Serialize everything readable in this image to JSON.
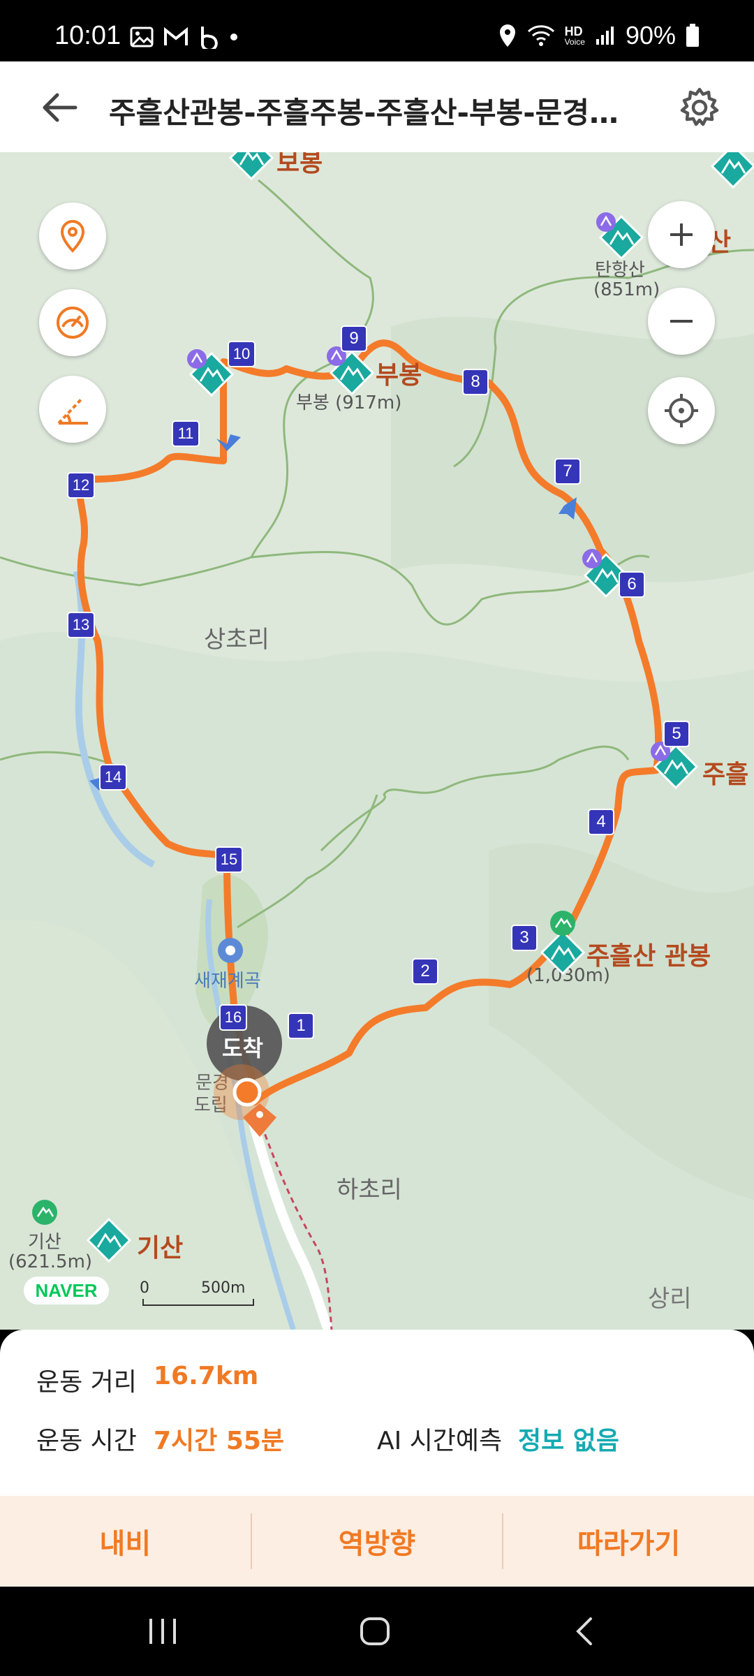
{
  "status_bar": {
    "time": "10:01",
    "battery": "90%",
    "hd_label": "HD",
    "voice_label": "Voice"
  },
  "header": {
    "title": "주흘산관봉-주흘주봉-주흘산-부봉-문경새...",
    "back_icon": "arrow-left-icon",
    "settings_icon": "gear-icon"
  },
  "map": {
    "places": {
      "sangcho": "상초리",
      "hacho": "하초리",
      "sangri": "상리",
      "saejae_valley": "새재계곡",
      "mungyeong_park": "문경",
      "mungyeong_park2": "도립",
      "arrival": "도착"
    },
    "peaks": {
      "bubong": "부봉",
      "bubong_alt": "부봉 (917m)",
      "tanhangsan": "탄항산",
      "tanhangsan_alt": "(851m)",
      "juheul_gwanbong": "주흘산 관봉",
      "juheul_gwanbong_alt": "(1,030m)",
      "juheul": "주흘",
      "gisan": "기산",
      "gisan_small": "기산",
      "gisan_alt": "(621.5m)",
      "bobong": "보봉",
      "partial_right": "산"
    },
    "waypoints": [
      "1",
      "2",
      "3",
      "4",
      "5",
      "6",
      "7",
      "8",
      "9",
      "10",
      "11",
      "12",
      "13",
      "14",
      "15",
      "16"
    ],
    "brand": "NAVER",
    "scale": {
      "start": "0",
      "end": "500m"
    },
    "route_color": "#f47b2a",
    "marker_color": "#3535b8",
    "peak_color": "#19a99e"
  },
  "summary": {
    "distance_label": "운동 거리",
    "distance_value": "16.7km",
    "time_label": "운동 시간",
    "time_value": "7시간 55분",
    "ai_label": "AI 시간예측",
    "ai_value": "정보 없음"
  },
  "actions": {
    "nav": "내비",
    "reverse": "역방향",
    "follow": "따라가기"
  }
}
